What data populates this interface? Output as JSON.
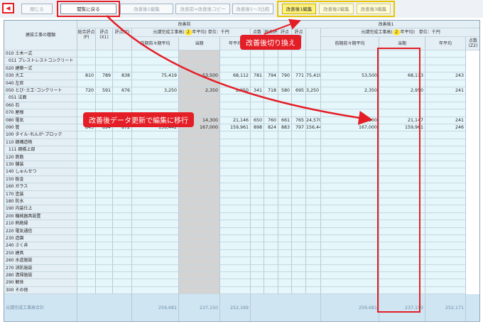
{
  "toolbar": {
    "back_icon": "◀",
    "buttons": [
      {
        "label": "閉じる",
        "state": "disabled"
      },
      {
        "label": "閲覧に戻る",
        "state": "active"
      },
      {
        "label": "改善後1編集",
        "state": "disabled"
      },
      {
        "label": "改善前⇒改善後コピー",
        "state": "disabled"
      },
      {
        "label": "改善後⇒改善前コピー",
        "state": "disabled"
      },
      {
        "label": "改善後1〜3比較",
        "state": "disabled"
      },
      {
        "label": "改善後1編集",
        "state": "yellow"
      },
      {
        "label": "改善後2編集",
        "state": "yellow2"
      },
      {
        "label": "改善後3編集",
        "state": "yellow2"
      }
    ]
  },
  "callouts": {
    "switch": "改善後切り換え",
    "edit": "改善後データ更新で編集に移行"
  },
  "table": {
    "corner_label": "建設工事の種類",
    "before_group": "改善前",
    "after_group": "改善後1",
    "avg_text_prefix": "元請完成工事高(",
    "avg_text_suffix": "年平均)",
    "years": "2",
    "unit_label": "単位：千円",
    "unit_label_short": "単位：千円",
    "col_sogo": "総合評点(P)",
    "col_x1": "評点(X1)",
    "col_z": "評点(Z)",
    "col_zenki": "前期前々期平均",
    "col_toki": "当期",
    "col_heikin": "年平均",
    "col_z1": "点数(Z1)",
    "col_z2": "点数(Z2)",
    "col_sogo_a": "総合評点(P)",
    "col_x1_a": "評点(X1)",
    "col_z_a": "評点(Z)",
    "total_label": "元請完成工事高合計",
    "totals": {
      "before": [
        "259,681",
        "237,150",
        "252,169"
      ],
      "after": [
        "259,681",
        "237,150",
        "252,171"
      ]
    },
    "rows": [
      {
        "label": "010 土木一式",
        "indent": 0,
        "v": []
      },
      {
        "label": "011 プレストレストコンクリート",
        "indent": 1,
        "v": []
      },
      {
        "label": "020 建築一式",
        "indent": 0,
        "v": []
      },
      {
        "label": "030 大工",
        "indent": 0,
        "v": [
          "810",
          "789",
          "838",
          "75,419",
          "53,500",
          "68,112",
          "781",
          "794",
          "790",
          "771",
          "75,419",
          "53,500",
          "68,113",
          "243"
        ]
      },
      {
        "label": "040 左官",
        "indent": 0,
        "v": []
      },
      {
        "label": "050 とび･土工･コンクリート",
        "indent": 0,
        "v": [
          "720",
          "591",
          "676",
          "3,250",
          "2,350",
          "2,950",
          "341",
          "718",
          "580",
          "695",
          "3,250",
          "2,350",
          "2,950",
          "241"
        ]
      },
      {
        "label": "051 法面",
        "indent": 1,
        "v": []
      },
      {
        "label": "060 石",
        "indent": 0,
        "v": []
      },
      {
        "label": "070 屋根",
        "indent": 0,
        "v": []
      },
      {
        "label": "080 電気",
        "indent": 0,
        "v": [
          "",
          "",
          "",
          "",
          "14,300",
          "21,146",
          "650",
          "760",
          "661",
          "765",
          "24,570",
          "14,300",
          "21,147",
          "241"
        ]
      },
      {
        "label": "090 管",
        "indent": 0,
        "v": [
          "845",
          "894",
          "872",
          "156,442",
          "167,000",
          "159,961",
          "898",
          "824",
          "883",
          "797",
          "156,442",
          "167,000",
          "159,961",
          "246"
        ]
      },
      {
        "label": "100 タイル･れんが･ブロック",
        "indent": 0,
        "v": []
      },
      {
        "label": "110 鋼構造物",
        "indent": 0,
        "v": []
      },
      {
        "label": "111 鋼橋上部",
        "indent": 1,
        "v": []
      },
      {
        "label": "120 鉄筋",
        "indent": 0,
        "v": []
      },
      {
        "label": "130 舗装",
        "indent": 0,
        "v": []
      },
      {
        "label": "140 しゅんせつ",
        "indent": 0,
        "v": []
      },
      {
        "label": "150 板金",
        "indent": 0,
        "v": []
      },
      {
        "label": "160 ガラス",
        "indent": 0,
        "v": []
      },
      {
        "label": "170 塗装",
        "indent": 0,
        "v": []
      },
      {
        "label": "180 防水",
        "indent": 0,
        "v": []
      },
      {
        "label": "190 内装仕上",
        "indent": 0,
        "v": []
      },
      {
        "label": "200 機械器具設置",
        "indent": 0,
        "v": []
      },
      {
        "label": "210 熱絶縁",
        "indent": 0,
        "v": []
      },
      {
        "label": "220 電気通信",
        "indent": 0,
        "v": []
      },
      {
        "label": "230 造園",
        "indent": 0,
        "v": []
      },
      {
        "label": "240 さく井",
        "indent": 0,
        "v": []
      },
      {
        "label": "250 建具",
        "indent": 0,
        "v": []
      },
      {
        "label": "260 水道施設",
        "indent": 0,
        "v": []
      },
      {
        "label": "270 消防施設",
        "indent": 0,
        "v": []
      },
      {
        "label": "280 清掃施設",
        "indent": 0,
        "v": []
      },
      {
        "label": "290 解体",
        "indent": 0,
        "v": []
      },
      {
        "label": "300 その他",
        "indent": 0,
        "v": []
      }
    ]
  },
  "colors": {
    "accent_red": "#e41e26",
    "highlight_yellow": "#ffe33c"
  }
}
